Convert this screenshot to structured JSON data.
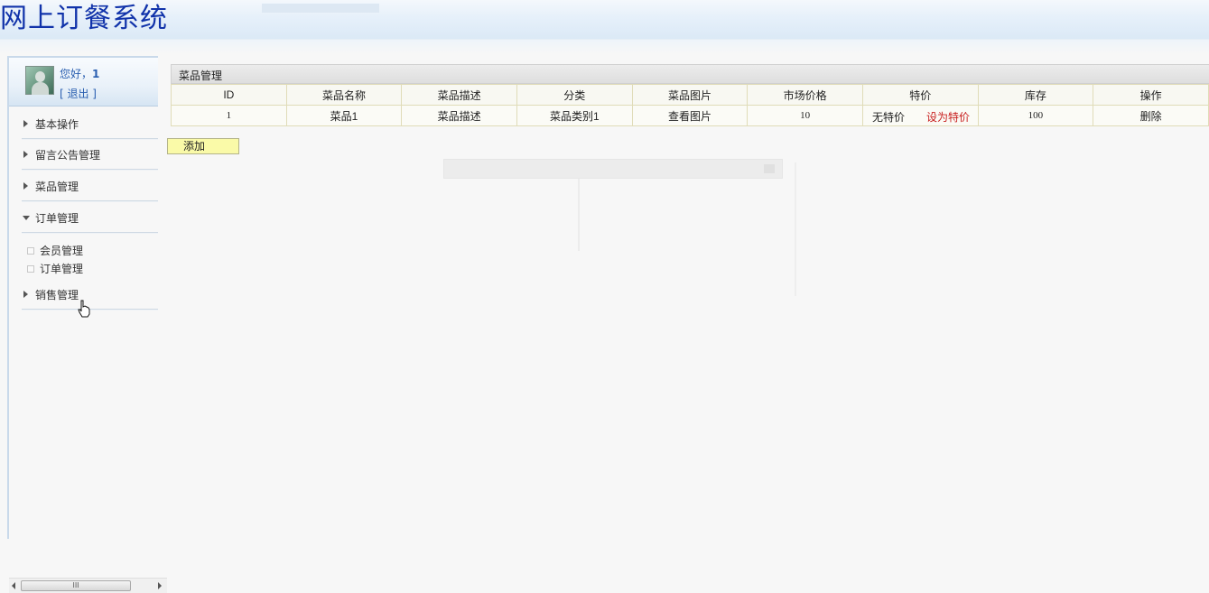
{
  "app": {
    "title": "网上订餐系统"
  },
  "user": {
    "greeting_prefix": "您好，",
    "name": "1",
    "logout": "[ 退出 ]"
  },
  "sidebar": {
    "menus": [
      {
        "label": "基本操作",
        "expanded": false
      },
      {
        "label": "留言公告管理",
        "expanded": false
      },
      {
        "label": "菜品管理",
        "expanded": false
      },
      {
        "label": "订单管理",
        "expanded": true
      },
      {
        "label": "销售管理",
        "expanded": false
      }
    ],
    "order_submenu": [
      "会员管理",
      "订单管理"
    ]
  },
  "scrollbar": {
    "thumb_glyph": "III"
  },
  "panel": {
    "title": "菜品管理",
    "columns": [
      "ID",
      "菜品名称",
      "菜品描述",
      "分类",
      "菜品图片",
      "市场价格",
      "特价",
      "库存",
      "操作"
    ],
    "rows": [
      {
        "id": "1",
        "name": "菜品1",
        "description": "菜品描述",
        "category": "菜品类别1",
        "image_link": "查看图片",
        "market_price": "10",
        "special_status": "无特价",
        "special_action": "设为特价",
        "stock": "100",
        "action": "删除"
      }
    ],
    "add_button": "添加"
  },
  "colors": {
    "title": "#1133aa",
    "link_red": "#c81e1e",
    "add_button_bg": "#fafaa8"
  }
}
